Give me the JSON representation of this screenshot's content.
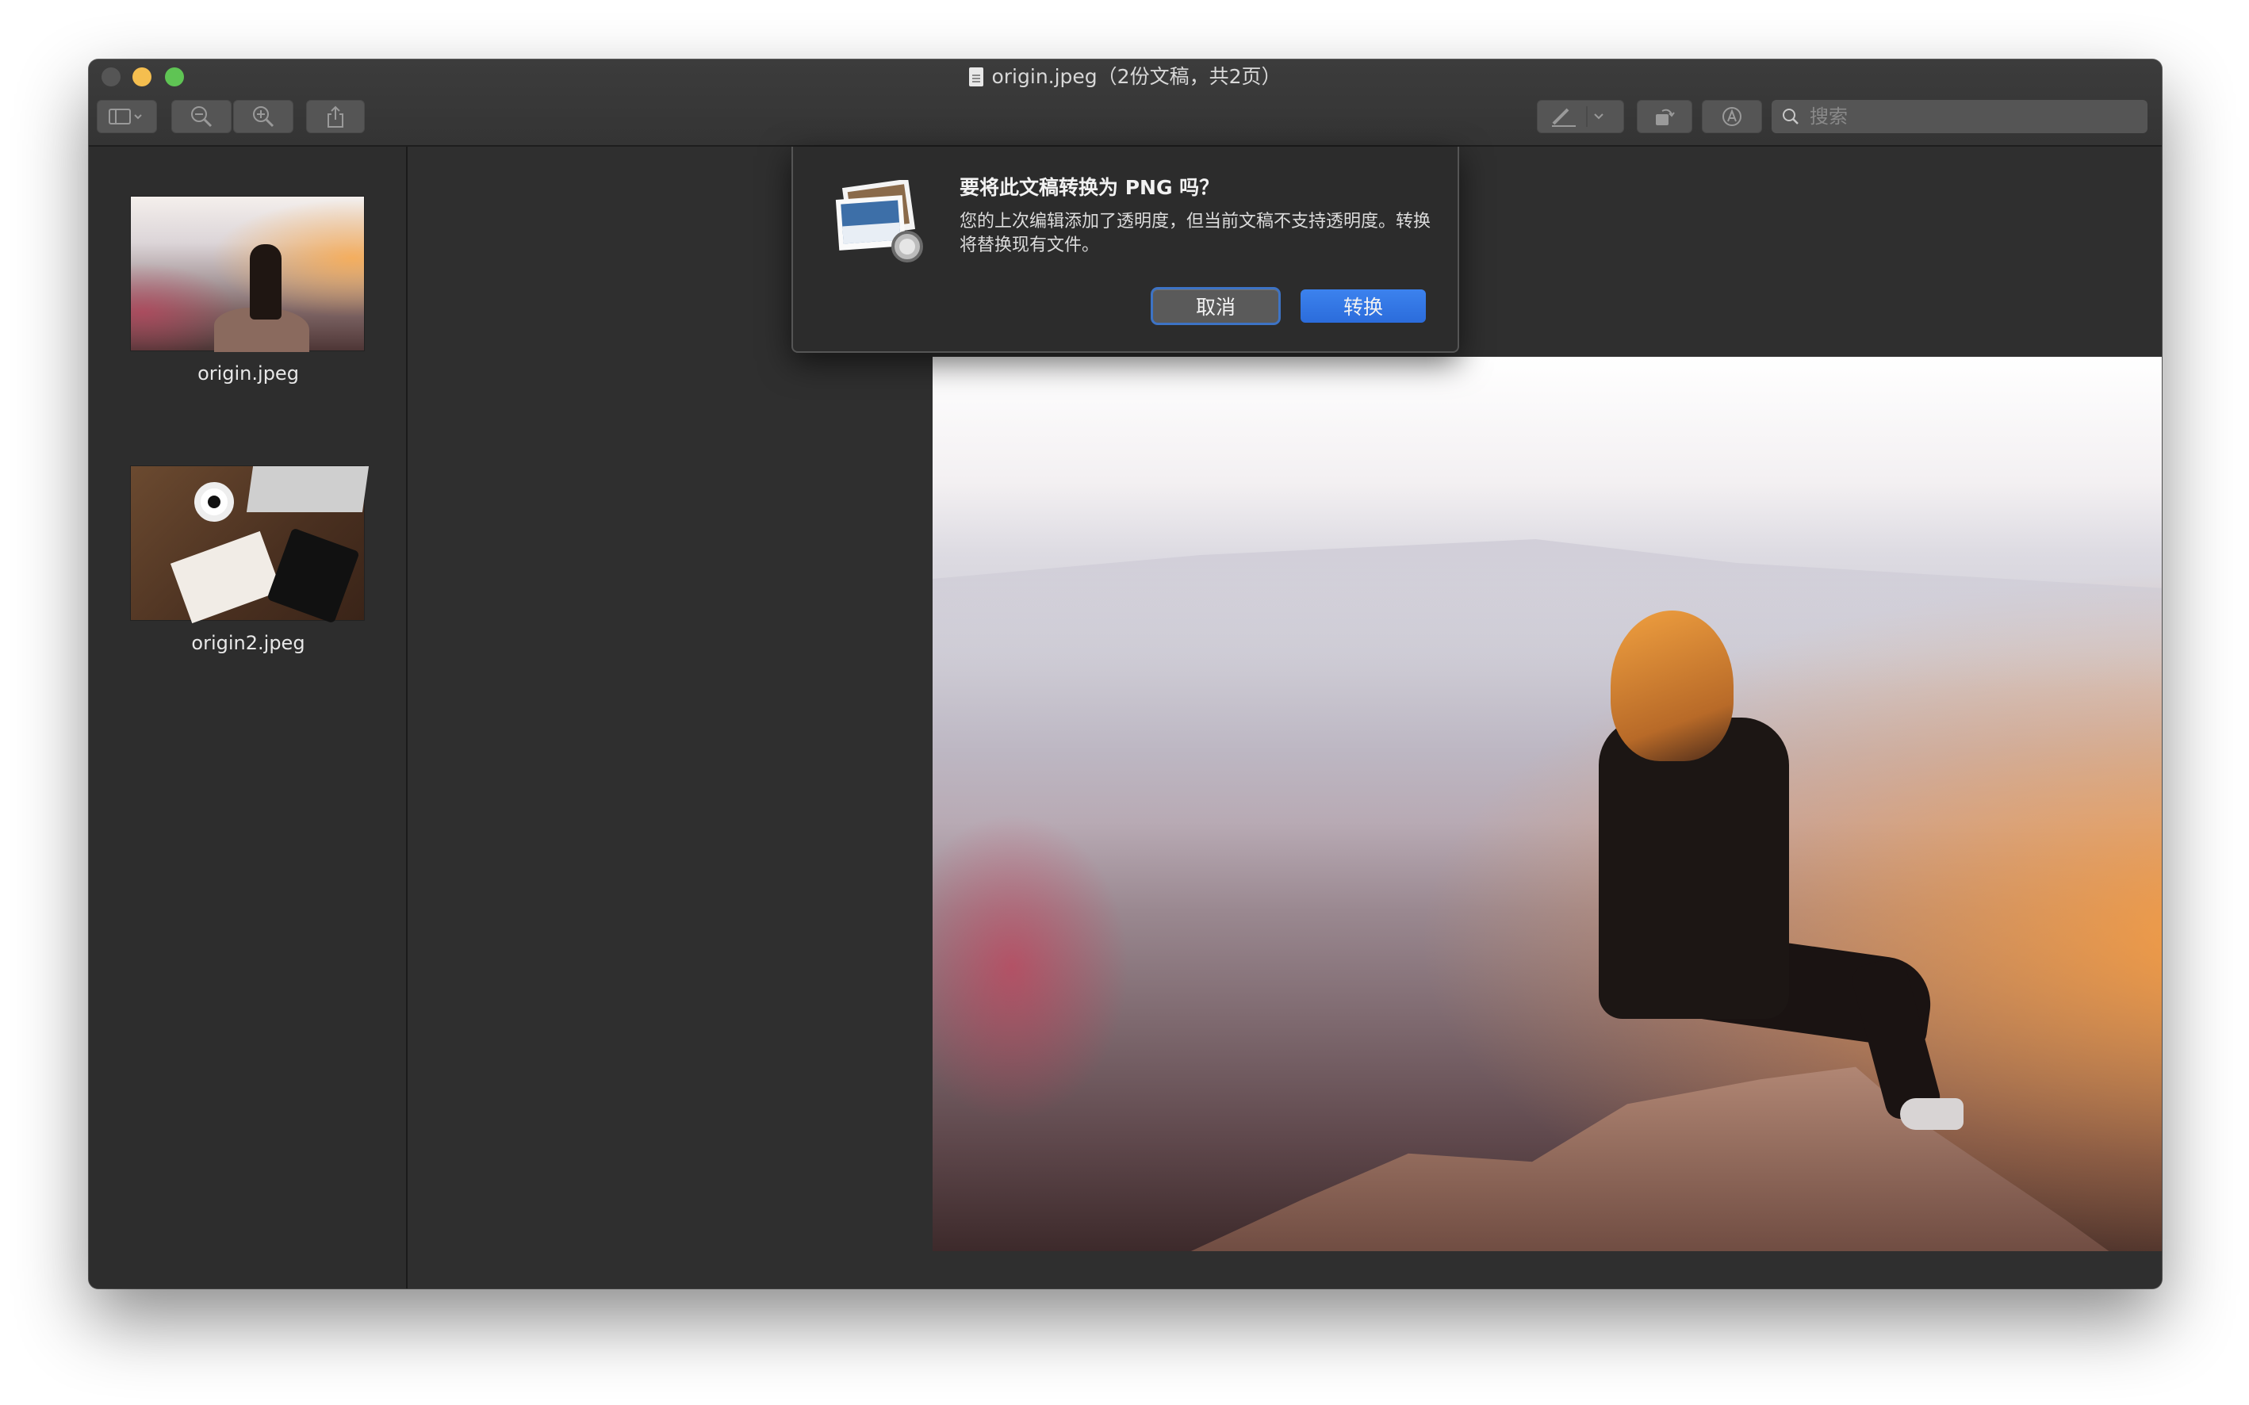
{
  "window": {
    "title": "origin.jpeg（2份文稿，共2页）"
  },
  "toolbar": {
    "search_placeholder": "搜索"
  },
  "sidebar": {
    "items": [
      {
        "label": "origin.jpeg"
      },
      {
        "label": "origin2.jpeg"
      }
    ]
  },
  "dialog": {
    "title": "要将此文稿转换为 PNG 吗？",
    "message": "您的上次编辑添加了透明度，但当前文稿不支持透明度。转换将替换现有文件。",
    "cancel_label": "取消",
    "convert_label": "转换"
  },
  "colors": {
    "accent": "#2b6cdb",
    "focus_ring": "#3d73c5",
    "window_bg": "#303030"
  }
}
